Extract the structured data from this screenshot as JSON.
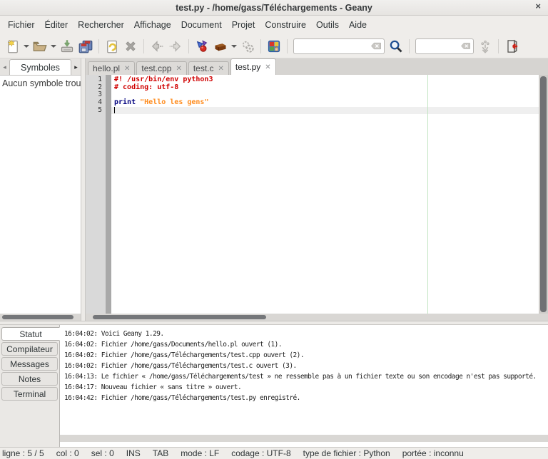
{
  "window": {
    "title": "test.py - /home/gass/Téléchargements - Geany"
  },
  "glyphs": {
    "window_close": "×",
    "tab_close": "✕",
    "dropdown_arrow": "▾",
    "side_arrow_left": "◂",
    "side_arrow_right": "▸"
  },
  "menubar": {
    "items": [
      "Fichier",
      "Éditer",
      "Rechercher",
      "Affichage",
      "Document",
      "Projet",
      "Construire",
      "Outils",
      "Aide"
    ]
  },
  "toolbar": {
    "icons": [
      "new-file-icon",
      "new-file-dropdown",
      "open-file-icon",
      "open-file-dropdown",
      "save-icon",
      "save-all-icon",
      "revert-icon",
      "close-file-icon",
      "nav-back-icon",
      "nav-forward-icon",
      "compile-icon",
      "build-icon",
      "build-dropdown",
      "run-icon",
      "color-chooser-icon",
      "search-clear-icon",
      "search-icon",
      "goto-clear-icon",
      "goto-line-icon",
      "quit-icon"
    ],
    "search_value": "",
    "goto_value": ""
  },
  "sidebar": {
    "tab_label": "Symboles",
    "empty_text": "Aucun symbole trouv"
  },
  "tabs": [
    {
      "label": "hello.pl",
      "active": false
    },
    {
      "label": "test.cpp",
      "active": false
    },
    {
      "label": "test.c",
      "active": false
    },
    {
      "label": "test.py",
      "active": true
    }
  ],
  "editor": {
    "colors": {
      "comment": "#d00000",
      "keyword": "#00007f",
      "string": "#ff8c1e",
      "plain": "#1a1a1a"
    },
    "margin_line_color": "#c3e6c3",
    "lines": [
      {
        "num": 1,
        "current": false,
        "segments": [
          {
            "style": "comment",
            "text": "#! /usr/bin/env python3"
          }
        ]
      },
      {
        "num": 2,
        "current": false,
        "segments": [
          {
            "style": "comment",
            "text": "# coding: utf-8"
          }
        ]
      },
      {
        "num": 3,
        "current": false,
        "segments": []
      },
      {
        "num": 4,
        "current": false,
        "segments": [
          {
            "style": "keyword",
            "text": "print"
          },
          {
            "style": "plain",
            "text": " "
          },
          {
            "style": "string",
            "text": "\"Hello les gens\""
          }
        ]
      },
      {
        "num": 5,
        "current": true,
        "segments": []
      }
    ]
  },
  "bottom_panel": {
    "tabs": [
      {
        "label": "Statut",
        "active": true
      },
      {
        "label": "Compilateur",
        "active": false
      },
      {
        "label": "Messages",
        "active": false
      },
      {
        "label": "Notes",
        "active": false
      },
      {
        "label": "Terminal",
        "active": false
      }
    ],
    "messages": [
      "16:04:02: Voici Geany 1.29.",
      "16:04:02: Fichier /home/gass/Documents/hello.pl ouvert (1).",
      "16:04:02: Fichier /home/gass/Téléchargements/test.cpp ouvert (2).",
      "16:04:02: Fichier /home/gass/Téléchargements/test.c ouvert (3).",
      "16:04:13: Le fichier « /home/gass/Téléchargements/test » ne ressemble pas à un fichier texte ou son encodage n'est pas supporté.",
      "16:04:17: Nouveau fichier « sans titre » ouvert.",
      "16:04:42: Fichier /home/gass/Téléchargements/test.py enregistré."
    ]
  },
  "statusbar": {
    "items": [
      "ligne : 5 / 5",
      "col : 0",
      "sel : 0",
      "INS",
      "TAB",
      "mode : LF",
      "codage : UTF-8",
      "type de fichier : Python",
      "portée : inconnu"
    ]
  }
}
